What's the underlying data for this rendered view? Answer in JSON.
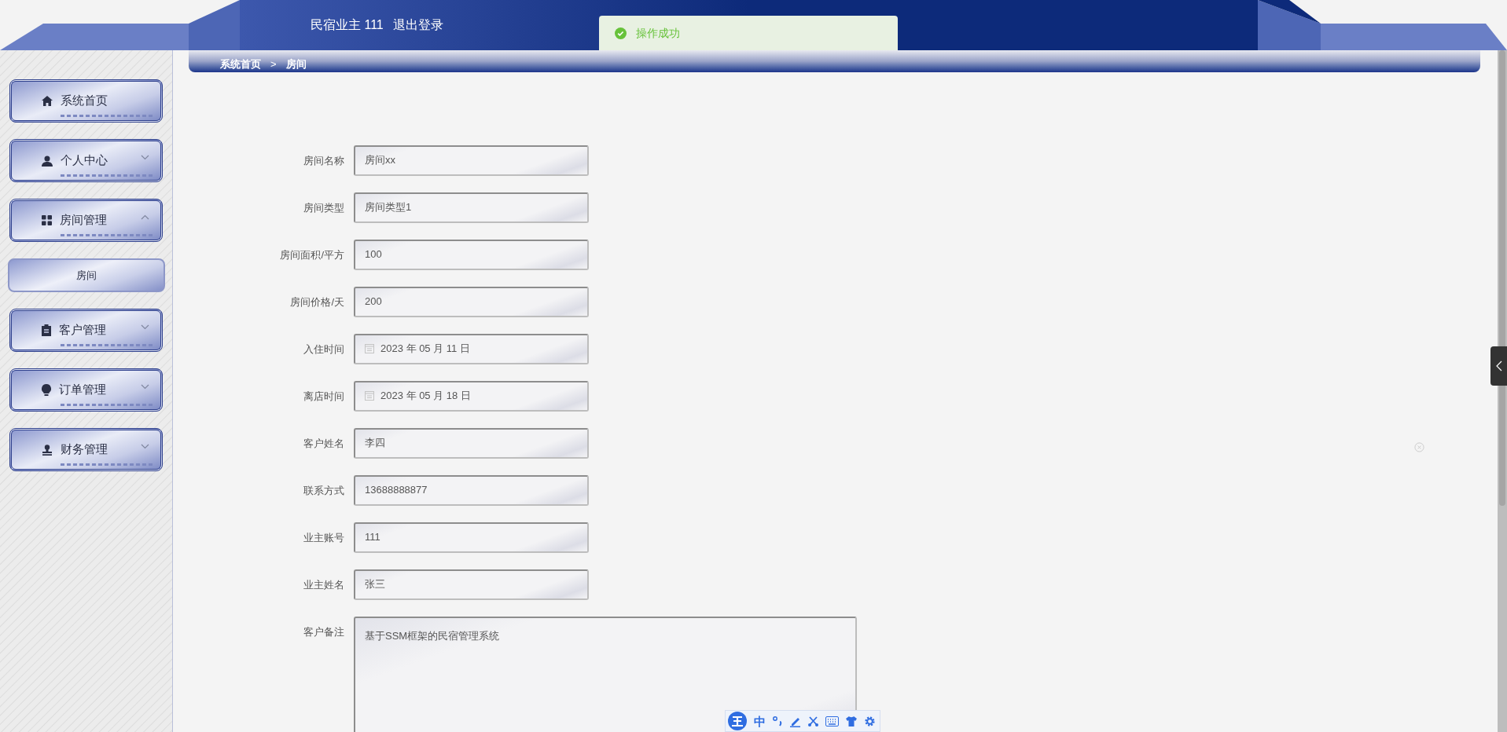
{
  "header": {
    "user_label": "民宿业主 111",
    "logout": "退出登录"
  },
  "toast": {
    "message": "操作成功"
  },
  "breadcrumb": {
    "items": [
      "系统首页",
      "房间"
    ],
    "separator": ">"
  },
  "sidebar": {
    "items": [
      {
        "label": "系统首页"
      },
      {
        "label": "个人中心",
        "expanded": false
      },
      {
        "label": "房间管理",
        "expanded": true,
        "children": [
          {
            "label": "房间",
            "selected": true
          }
        ]
      },
      {
        "label": "客户管理",
        "expanded": false
      },
      {
        "label": "订单管理",
        "expanded": false
      },
      {
        "label": "财务管理",
        "expanded": false
      }
    ]
  },
  "form": {
    "fields": [
      {
        "label": "房间名称",
        "value": "房间xx",
        "kind": "text"
      },
      {
        "label": "房间类型",
        "value": "房间类型1",
        "kind": "text"
      },
      {
        "label": "房间面积/平方",
        "value": "100",
        "kind": "text"
      },
      {
        "label": "房间价格/天",
        "value": "200",
        "kind": "text"
      },
      {
        "label": "入住时间",
        "value": "2023 年 05 月 11 日",
        "kind": "date"
      },
      {
        "label": "离店时间",
        "value": "2023 年 05 月 18 日",
        "kind": "date"
      },
      {
        "label": "客户姓名",
        "value": "李四",
        "kind": "text"
      },
      {
        "label": "联系方式",
        "value": "13688888877",
        "kind": "text"
      },
      {
        "label": "业主账号",
        "value": "111",
        "kind": "text"
      },
      {
        "label": "业主姓名",
        "value": "张三",
        "kind": "text"
      },
      {
        "label": "客户备注",
        "value": "基于SSM框架的民宿管理系统",
        "kind": "textarea"
      }
    ]
  },
  "ime_toolbar": {
    "mode": "中"
  }
}
